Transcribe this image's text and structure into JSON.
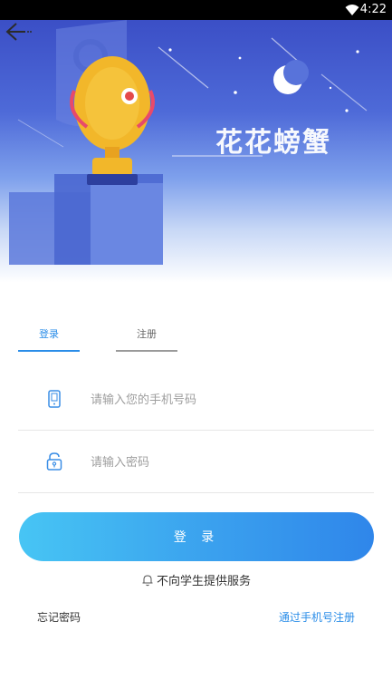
{
  "status_bar": {
    "time": "4:22",
    "wifi_icon": "wifi-icon"
  },
  "header": {
    "app_name": "花花螃蟹",
    "back_icon": "back-arrow-icon"
  },
  "tabs": [
    {
      "label": "登录",
      "active": true
    },
    {
      "label": "注册",
      "active": false
    }
  ],
  "form": {
    "phone_placeholder": "请输入您的手机号码",
    "phone_icon": "phone-icon",
    "password_placeholder": "请输入密码",
    "password_icon": "lock-icon"
  },
  "actions": {
    "login_label": "登 录",
    "notice": "不向学生提供服务",
    "notice_icon": "bell-icon",
    "forgot_password": "忘记密码",
    "register_by_phone": "通过手机号注册"
  },
  "colors": {
    "accent": "#2a8de8",
    "button_gradient_start": "#47c5f4",
    "button_gradient_end": "#2f86ea",
    "hero_top": "#3b4fc6"
  }
}
